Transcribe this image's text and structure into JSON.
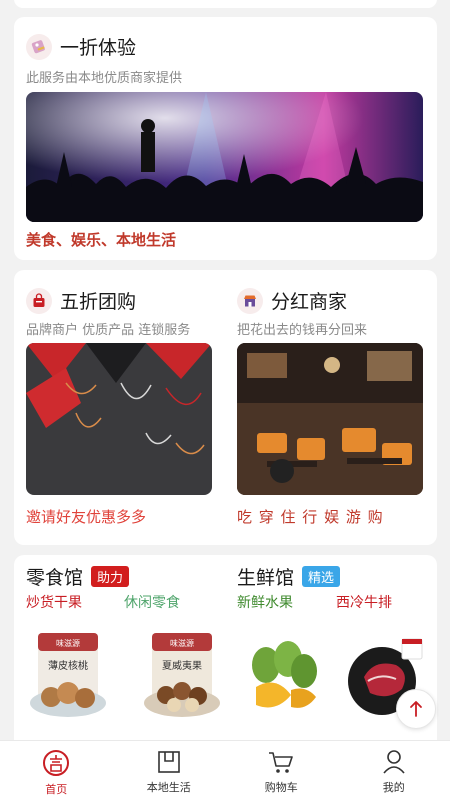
{
  "deal_one": {
    "title": "一折体验",
    "subtitle": "此服务由本地优质商家提供",
    "tagline": "美食、娱乐、本地生活",
    "icon": "tag-icon",
    "tagline_color": "#c0392b"
  },
  "group_half": {
    "title": "五折团购",
    "subtitle": "品牌商户  优质产品  连锁服务",
    "tagline": "邀请好友优惠多多",
    "icon": "shopping-bag-icon",
    "tagline_color": "#e0433b"
  },
  "dividend": {
    "title": "分红商家",
    "subtitle": "把花出去的钱再分回来",
    "tagline": "吃 穿 住 行 娱 游 购",
    "icon": "storefront-icon",
    "tagline_color": "#c0392b"
  },
  "snack_hall": {
    "title": "零食馆",
    "badge": "助力",
    "badge_color": "#d21e1e",
    "keywords": [
      "炒货干果",
      "休闲零食"
    ],
    "keyword_colors": [
      "#c81e24",
      "#4fa46b"
    ],
    "products": [
      {
        "name": "walnut-pack",
        "brand": "味滋源",
        "label": "薄皮核桃"
      },
      {
        "name": "macadamia-pack",
        "brand": "味滋源",
        "label": "夏威夷果"
      }
    ]
  },
  "fresh_hall": {
    "title": "生鲜馆",
    "badge": "精选",
    "badge_color": "#3aa6e8",
    "keywords": [
      "新鲜水果",
      "西冷牛排"
    ],
    "keyword_colors": [
      "#3f8a2e",
      "#c81e24"
    ],
    "products": [
      {
        "name": "mango-fruit"
      },
      {
        "name": "sirloin-steak"
      }
    ]
  },
  "tabbar": {
    "items": [
      {
        "label": "首页",
        "icon": "home-logo-icon",
        "active": true
      },
      {
        "label": "本地生活",
        "icon": "local-life-icon",
        "active": false
      },
      {
        "label": "购物车",
        "icon": "cart-icon",
        "active": false
      },
      {
        "label": "我的",
        "icon": "profile-icon",
        "active": false
      }
    ]
  },
  "accent_color": "#c81e24"
}
